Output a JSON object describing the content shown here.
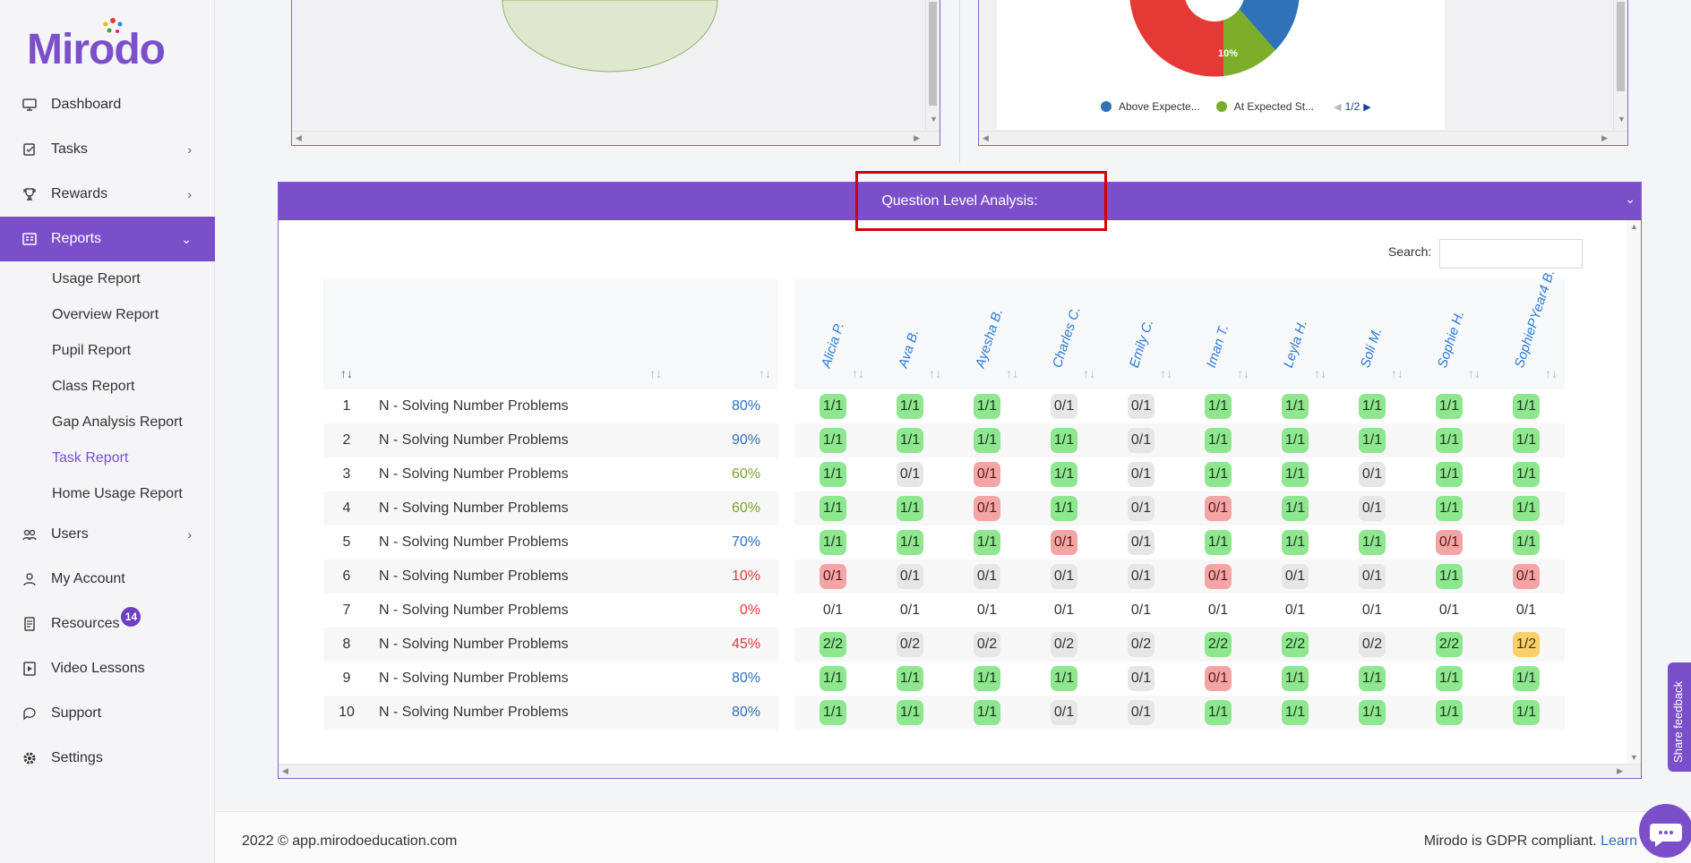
{
  "brand": {
    "logo": "Mirodo",
    "accent": "#7b4fc9"
  },
  "sidebar": {
    "items": [
      {
        "label": "Dashboard",
        "icon": "monitor-icon"
      },
      {
        "label": "Tasks",
        "icon": "tasks-icon",
        "chevron": "›"
      },
      {
        "label": "Rewards",
        "icon": "trophy-icon",
        "chevron": "›"
      },
      {
        "label": "Reports",
        "icon": "reports-icon",
        "chevron": "⌄"
      },
      {
        "label": "Users",
        "icon": "users-icon",
        "chevron": "›"
      },
      {
        "label": "My Account",
        "icon": "account-icon"
      },
      {
        "label": "Resources",
        "icon": "resources-icon",
        "badge": "14"
      },
      {
        "label": "Video Lessons",
        "icon": "video-icon"
      },
      {
        "label": "Support",
        "icon": "support-icon"
      },
      {
        "label": "Settings",
        "icon": "gear-icon"
      }
    ],
    "reports_sub": [
      "Usage Report",
      "Overview Report",
      "Pupil Report",
      "Class Report",
      "Gap Analysis Report",
      "Task Report",
      "Home Usage Report"
    ]
  },
  "pie": {
    "slice_label": "10%",
    "legend": [
      "Above Expecte...",
      "At Expected St..."
    ],
    "pager": "1/2",
    "colors": {
      "above": "#2f72b8",
      "at": "#7cae2a",
      "below": "#e53935"
    }
  },
  "qla": {
    "title": "Question Level Analysis:",
    "search_label": "Search:",
    "search_value": "",
    "pupils": [
      "Alicia P.",
      "Ava B.",
      "Ayesha B.",
      "Charles C.",
      "Emily C.",
      "Iman T.",
      "Leyla H.",
      "Soli M.",
      "Sophie H.",
      "SophiePYear4 B."
    ],
    "rows": [
      {
        "n": "1",
        "q": "N - Solving Number Problems",
        "pct": "80%",
        "pcolor": "blue",
        "s": [
          "1/1",
          "1/1",
          "1/1",
          "0/1",
          "0/1",
          "1/1",
          "1/1",
          "1/1",
          "1/1",
          "1/1"
        ],
        "c": [
          "g",
          "g",
          "g",
          "x",
          "x",
          "g",
          "g",
          "g",
          "g",
          "g"
        ]
      },
      {
        "n": "2",
        "q": "N - Solving Number Problems",
        "pct": "90%",
        "pcolor": "blue",
        "s": [
          "1/1",
          "1/1",
          "1/1",
          "1/1",
          "0/1",
          "1/1",
          "1/1",
          "1/1",
          "1/1",
          "1/1"
        ],
        "c": [
          "g",
          "g",
          "g",
          "g",
          "x",
          "g",
          "g",
          "g",
          "g",
          "g"
        ]
      },
      {
        "n": "3",
        "q": "N - Solving Number Problems",
        "pct": "60%",
        "pcolor": "green",
        "s": [
          "1/1",
          "0/1",
          "0/1",
          "1/1",
          "0/1",
          "1/1",
          "1/1",
          "0/1",
          "1/1",
          "1/1"
        ],
        "c": [
          "g",
          "x",
          "r",
          "g",
          "x",
          "g",
          "g",
          "x",
          "g",
          "g"
        ]
      },
      {
        "n": "4",
        "q": "N - Solving Number Problems",
        "pct": "60%",
        "pcolor": "green",
        "s": [
          "1/1",
          "1/1",
          "0/1",
          "1/1",
          "0/1",
          "0/1",
          "1/1",
          "0/1",
          "1/1",
          "1/1"
        ],
        "c": [
          "g",
          "g",
          "r",
          "g",
          "x",
          "r",
          "g",
          "x",
          "g",
          "g"
        ]
      },
      {
        "n": "5",
        "q": "N - Solving Number Problems",
        "pct": "70%",
        "pcolor": "blue",
        "s": [
          "1/1",
          "1/1",
          "1/1",
          "0/1",
          "0/1",
          "1/1",
          "1/1",
          "1/1",
          "0/1",
          "1/1"
        ],
        "c": [
          "g",
          "g",
          "g",
          "r",
          "x",
          "g",
          "g",
          "g",
          "r",
          "g"
        ]
      },
      {
        "n": "6",
        "q": "N - Solving Number Problems",
        "pct": "10%",
        "pcolor": "red",
        "s": [
          "0/1",
          "0/1",
          "0/1",
          "0/1",
          "0/1",
          "0/1",
          "0/1",
          "0/1",
          "1/1",
          "0/1"
        ],
        "c": [
          "r",
          "x",
          "x",
          "x",
          "x",
          "r",
          "x",
          "x",
          "g",
          "r"
        ]
      },
      {
        "n": "7",
        "q": "N - Solving Number Problems",
        "pct": "0%",
        "pcolor": "red",
        "s": [
          "0/1",
          "0/1",
          "0/1",
          "0/1",
          "0/1",
          "0/1",
          "0/1",
          "0/1",
          "0/1",
          "0/1"
        ],
        "c": [
          "n",
          "n",
          "n",
          "n",
          "n",
          "n",
          "n",
          "n",
          "n",
          "n"
        ]
      },
      {
        "n": "8",
        "q": "N - Solving Number Problems",
        "pct": "45%",
        "pcolor": "red",
        "s": [
          "2/2",
          "0/2",
          "0/2",
          "0/2",
          "0/2",
          "2/2",
          "2/2",
          "0/2",
          "2/2",
          "1/2"
        ],
        "c": [
          "g",
          "x",
          "x",
          "x",
          "x",
          "g",
          "g",
          "x",
          "g",
          "a"
        ]
      },
      {
        "n": "9",
        "q": "N - Solving Number Problems",
        "pct": "80%",
        "pcolor": "blue",
        "s": [
          "1/1",
          "1/1",
          "1/1",
          "1/1",
          "0/1",
          "0/1",
          "1/1",
          "1/1",
          "1/1",
          "1/1"
        ],
        "c": [
          "g",
          "g",
          "g",
          "g",
          "x",
          "r",
          "g",
          "g",
          "g",
          "g"
        ]
      },
      {
        "n": "10",
        "q": "N - Solving Number Problems",
        "pct": "80%",
        "pcolor": "blue",
        "s": [
          "1/1",
          "1/1",
          "1/1",
          "0/1",
          "0/1",
          "1/1",
          "1/1",
          "1/1",
          "1/1",
          "1/1"
        ],
        "c": [
          "g",
          "g",
          "g",
          "x",
          "x",
          "g",
          "g",
          "g",
          "g",
          "g"
        ]
      }
    ]
  },
  "footer": {
    "copyright": "2022 © app.mirodoeducation.com",
    "gdpr": "Mirodo is GDPR compliant. ",
    "learn": "Learn"
  },
  "feedback_label": "Share feedback"
}
